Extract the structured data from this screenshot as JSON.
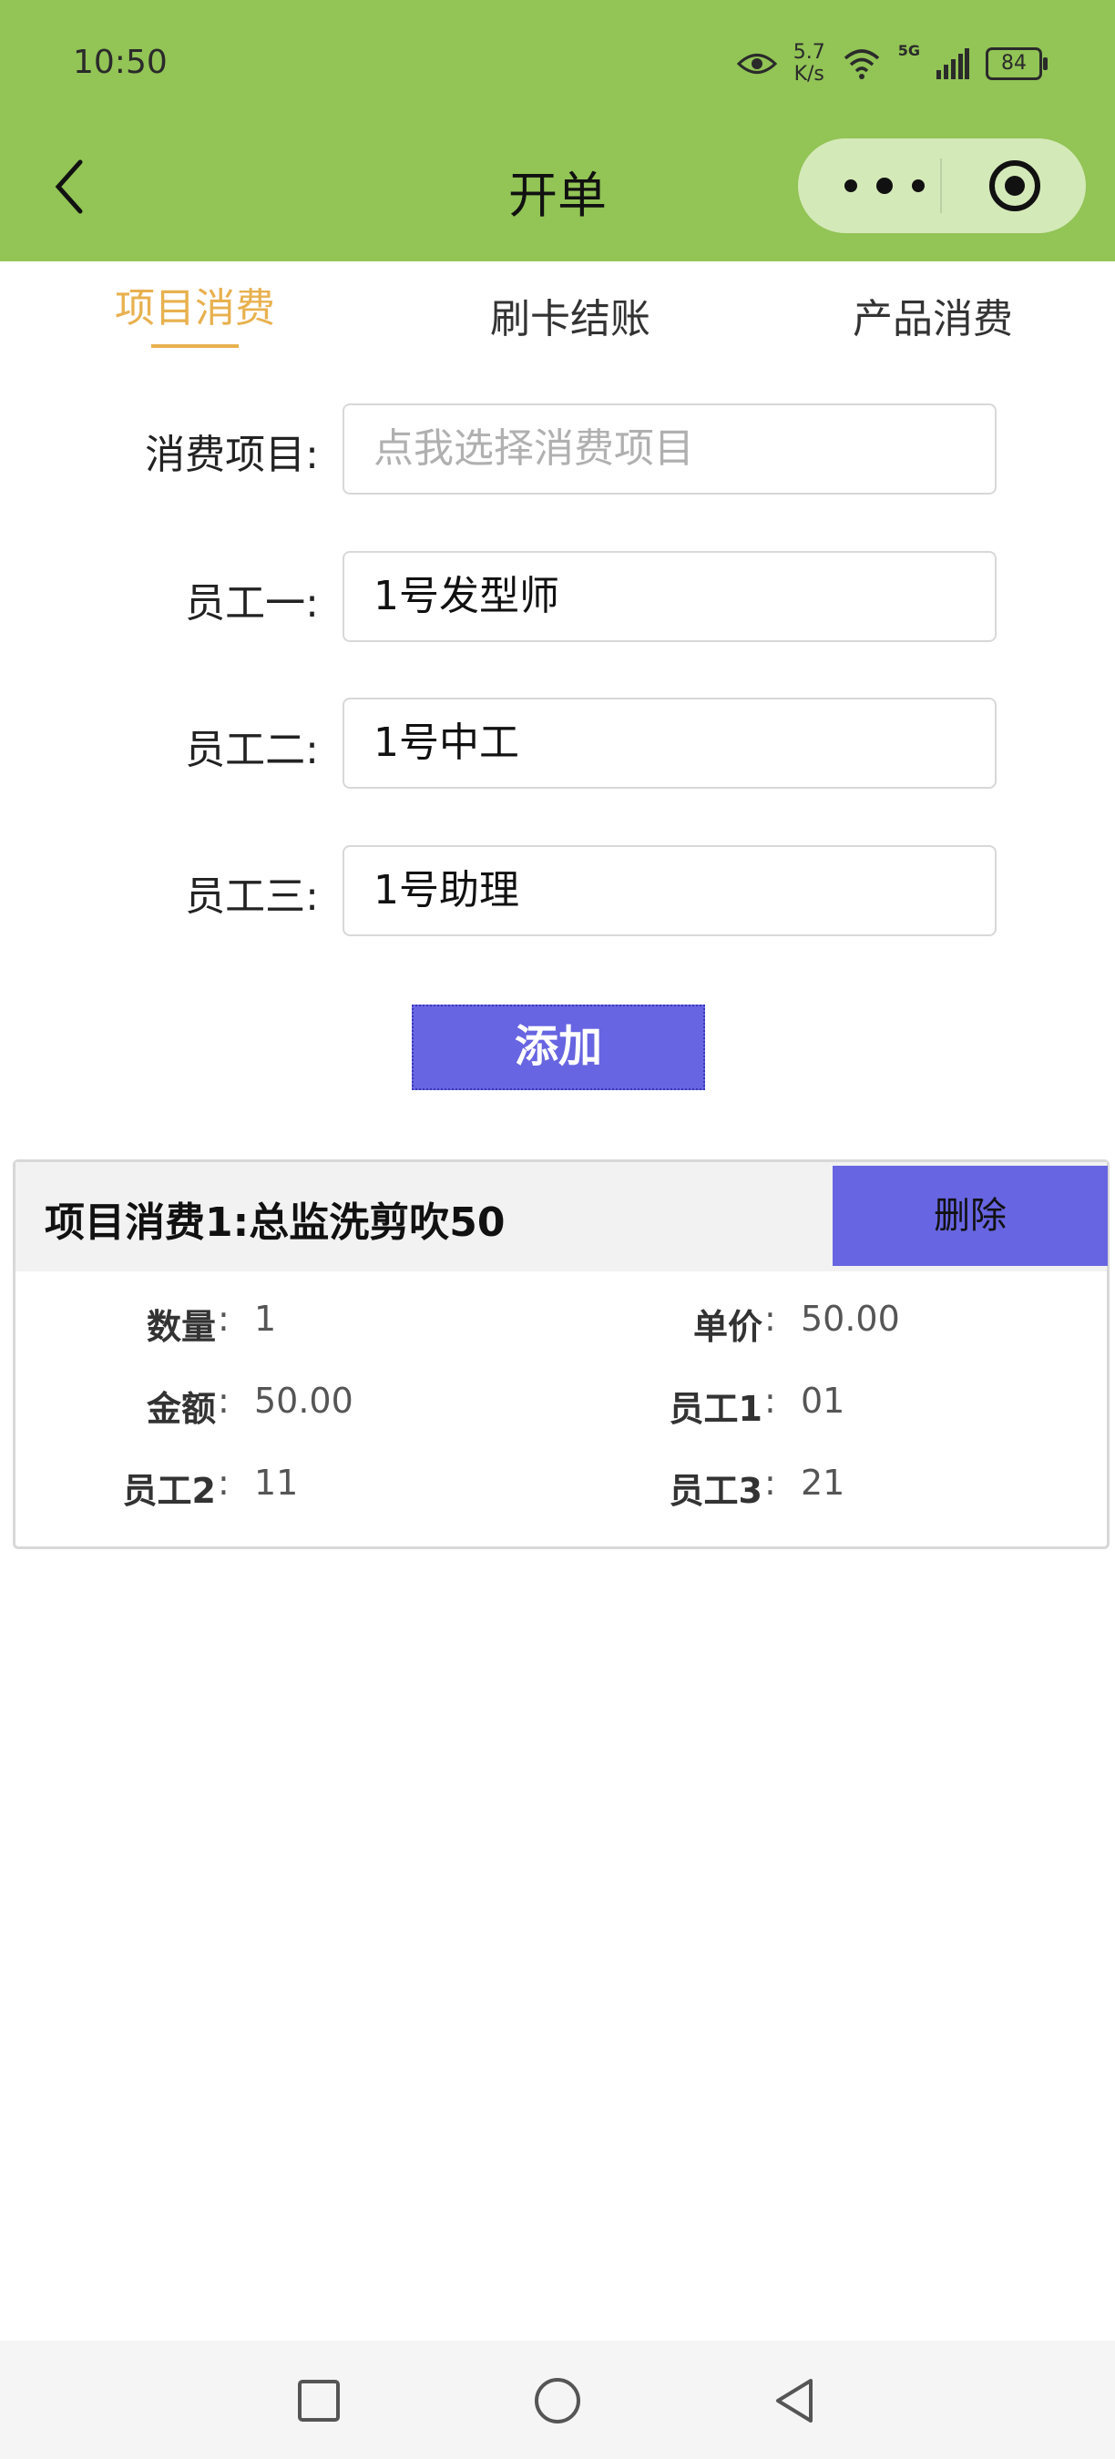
{
  "status_bar": {
    "time": "10:50",
    "speed_value": "5.7",
    "speed_unit": "K/s",
    "network": "5G",
    "battery": "84"
  },
  "header": {
    "title": "开单"
  },
  "tabs": [
    {
      "label": "项目消费",
      "active": true
    },
    {
      "label": "刷卡结账",
      "active": false
    },
    {
      "label": "产品消费",
      "active": false
    }
  ],
  "form": {
    "item_label": "消费项目:",
    "item_placeholder": "点我选择消费项目",
    "staff1_label": "员工一:",
    "staff1_value": "1号发型师",
    "staff2_label": "员工二:",
    "staff2_value": "1号中工",
    "staff3_label": "员工三:",
    "staff3_value": "1号助理",
    "add_button": "添加"
  },
  "order_card": {
    "title": "项目消费1:总监洗剪吹50",
    "delete_button": "删除",
    "fields": {
      "qty_label": "数量",
      "qty_value": "1",
      "price_label": "单价",
      "price_value": "50.00",
      "amount_label": "金额",
      "amount_value": "50.00",
      "staff1_label": "员工1",
      "staff1_value": "01",
      "staff2_label": "员工2",
      "staff2_value": "11",
      "staff3_label": "员工3",
      "staff3_value": "21"
    },
    "colon": ":"
  },
  "colors": {
    "header_green": "#92c456",
    "tab_active": "#e8b14f",
    "button_purple": "#6765e1"
  },
  "icons": [
    "back-arrow-icon",
    "more-dots-icon",
    "target-icon",
    "eye-icon",
    "wifi-icon",
    "signal-icon",
    "square-nav-icon",
    "circle-nav-icon",
    "triangle-back-nav-icon"
  ]
}
